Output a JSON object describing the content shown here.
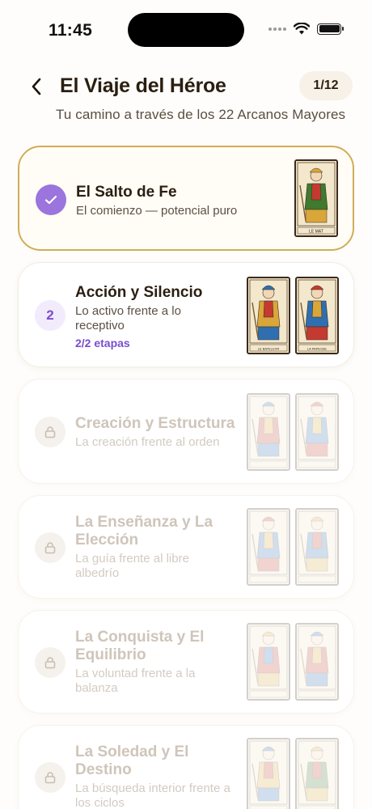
{
  "status": {
    "time": "11:45"
  },
  "header": {
    "title": "El Viaje del Héroe",
    "page_indicator": "1/12",
    "subtitle": "Tu camino a través de los 22 Arcanos Mayores"
  },
  "stages": [
    {
      "state": "completed",
      "title": "El Salto de Fe",
      "description": "El comienzo — potencial puro",
      "cards": [
        {
          "name": "LE MAT",
          "palette": [
            "#d9a63a",
            "#3f7a2e",
            "#c43a30"
          ]
        }
      ]
    },
    {
      "state": "active",
      "number": "2",
      "title": "Acción y Silencio",
      "description_lines": [
        "Lo activo frente a lo",
        "receptivo"
      ],
      "progress": "2/2 etapas",
      "cards": [
        {
          "name": "LE BATELEVR",
          "palette": [
            "#2f6fb0",
            "#d9a63a",
            "#c43a30"
          ]
        },
        {
          "name": "LA PAPESSE",
          "palette": [
            "#c43a30",
            "#2f6fb0",
            "#d9a63a"
          ]
        }
      ]
    },
    {
      "state": "locked",
      "title": "Creación y Estructura",
      "description_lines": [
        "La creación frente al orden"
      ],
      "cards": [
        {
          "palette": [
            "#2f6fb0",
            "#c43a30",
            "#d9a63a"
          ]
        },
        {
          "palette": [
            "#c43a30",
            "#2f6fb0",
            "#d9a63a"
          ]
        }
      ]
    },
    {
      "state": "locked",
      "title_lines": [
        "La Enseñanza y La",
        "Elección"
      ],
      "description_lines": [
        "La guía frente al libre",
        "albedrío"
      ],
      "cards": [
        {
          "palette": [
            "#c43a30",
            "#2f6fb0",
            "#d9a63a"
          ]
        },
        {
          "palette": [
            "#d9a63a",
            "#2f6fb0",
            "#c43a30"
          ]
        }
      ]
    },
    {
      "state": "locked",
      "title_lines": [
        "La Conquista y El",
        "Equilibrio"
      ],
      "description_lines": [
        "La voluntad frente a la",
        "balanza"
      ],
      "cards": [
        {
          "palette": [
            "#d9a63a",
            "#c43a30",
            "#2f6fb0"
          ]
        },
        {
          "palette": [
            "#2f6fb0",
            "#c43a30",
            "#d9a63a"
          ]
        }
      ]
    },
    {
      "state": "locked",
      "title_lines": [
        "La Soledad y El",
        "Destino"
      ],
      "description_lines": [
        "La búsqueda interior frente a",
        "los ciclos"
      ],
      "cards": [
        {
          "palette": [
            "#2f6fb0",
            "#d9a63a",
            "#c43a30"
          ]
        },
        {
          "palette": [
            "#d9a63a",
            "#3f7a2e",
            "#c43a30"
          ]
        }
      ]
    }
  ],
  "colors": {
    "accent_gold": "#d2ac58",
    "accent_purple": "#9b74de",
    "text_dark": "#2a1e10"
  }
}
